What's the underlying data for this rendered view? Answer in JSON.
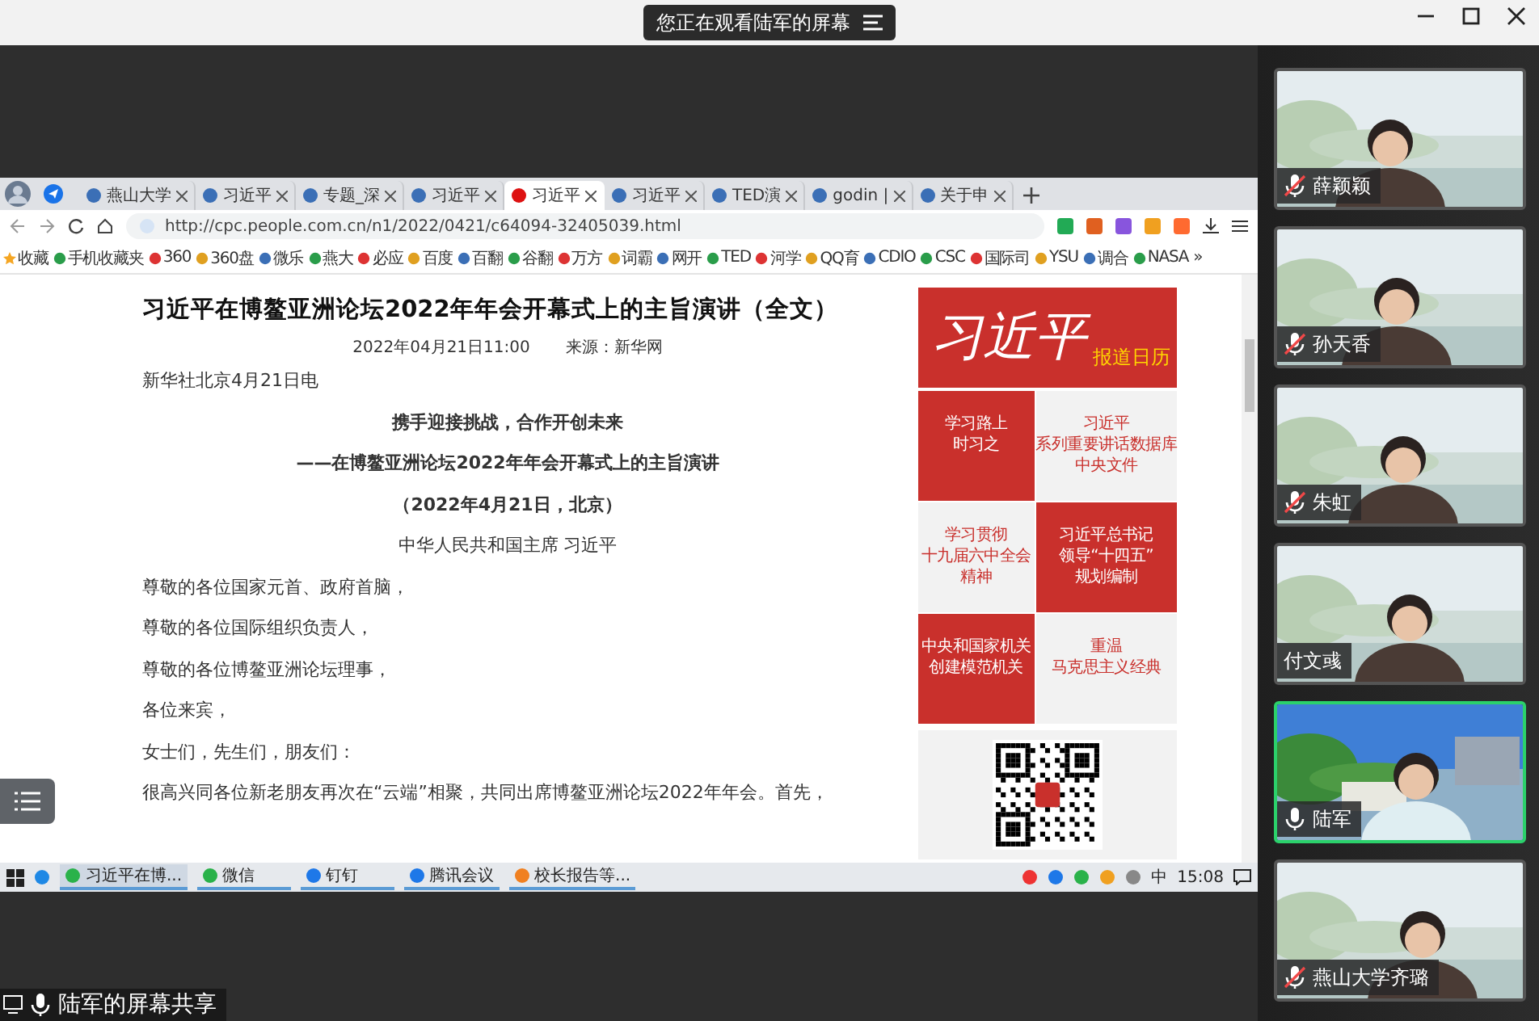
{
  "topbar": {
    "viewing": "您正在观看陆军的屏幕"
  },
  "browser": {
    "tabs": [
      {
        "title": "燕山大学",
        "selected": false
      },
      {
        "title": "习近平",
        "selected": false
      },
      {
        "title": "专题_深",
        "selected": false
      },
      {
        "title": "习近平",
        "selected": false
      },
      {
        "title": "习近平",
        "selected": true
      },
      {
        "title": "习近平",
        "selected": false
      },
      {
        "title": "TED演",
        "selected": false
      },
      {
        "title": "godin |",
        "selected": false
      },
      {
        "title": "关于申",
        "selected": false
      }
    ],
    "url": "http://cpc.people.com.cn/n1/2022/0421/c64094-32405039.html",
    "bookmarks": [
      "收藏",
      "手机收藏夹",
      "360",
      "360盘",
      "微乐",
      "燕大",
      "必应",
      "百度",
      "百翻",
      "谷翻",
      "万方",
      "词霸",
      "网开",
      "TED",
      "河学",
      "QQ育",
      "CDIO",
      "CSC",
      "国际司",
      "YSU",
      "调合",
      "NASA"
    ],
    "more": "»"
  },
  "article": {
    "title": "习近平在博鳌亚洲论坛2022年年会开幕式上的主旨演讲（全文）",
    "date": "2022年04月21日11:00",
    "source": "来源：新华网",
    "dateline": "新华社北京4月21日电",
    "headings": [
      "携手迎接挑战，合作开创未来",
      "——在博鳌亚洲论坛2022年年会开幕式上的主旨演讲",
      "（2022年4月21日，北京）"
    ],
    "byline": "中华人民共和国主席 习近平",
    "paragraphs": [
      "尊敬的各位国家元首、政府首脑，",
      "尊敬的各位国际组织负责人，",
      "尊敬的各位博鳌亚洲论坛理事，",
      "各位来宾，",
      "女士们，先生们，朋友们：",
      "很高兴同各位新老朋友再次在“云端”相聚，共同出席博鳌亚洲论坛2022年年会。首先，"
    ]
  },
  "sidebar": {
    "banner_title": "习近平",
    "banner_subtitle": "报道日历",
    "tiles": [
      {
        "lines": [
          "学习路上",
          "时习之"
        ],
        "highlighted": true
      },
      {
        "lines": [
          "习近平",
          "系列重要讲话数据库",
          "中央文件"
        ],
        "highlighted": false
      },
      {
        "lines": [
          "学习贯彻",
          "十九届六中全会",
          "精神"
        ],
        "highlighted": false
      },
      {
        "lines": [
          "习近平总书记",
          "领导“十四五”",
          "规划编制"
        ],
        "highlighted": true
      },
      {
        "lines": [
          "中央和国家机关",
          "创建模范机关"
        ],
        "highlighted": true
      },
      {
        "lines": [
          "重温",
          "马克思主义经典"
        ],
        "highlighted": false
      }
    ]
  },
  "taskbar": {
    "apps": [
      {
        "label": "习近平在博...",
        "selected": true
      },
      {
        "label": "微信",
        "selected": false
      },
      {
        "label": "钉钉",
        "selected": false
      },
      {
        "label": "腾讯会议",
        "selected": false
      },
      {
        "label": "校长报告等...",
        "selected": false
      }
    ],
    "ime": "中",
    "time": "15:08"
  },
  "participants": [
    {
      "name": "薛颖颖",
      "kind": "muted",
      "active": false
    },
    {
      "name": "孙天香",
      "kind": "muted",
      "active": false
    },
    {
      "name": "朱虹",
      "kind": "muted",
      "active": false
    },
    {
      "name": "付文彧",
      "kind": "plain",
      "active": false
    },
    {
      "name": "陆军",
      "kind": "unmuted",
      "active": true
    },
    {
      "name": "燕山大学齐璐",
      "kind": "muted",
      "active": false
    }
  ],
  "share_label": "陆军的屏幕共享"
}
